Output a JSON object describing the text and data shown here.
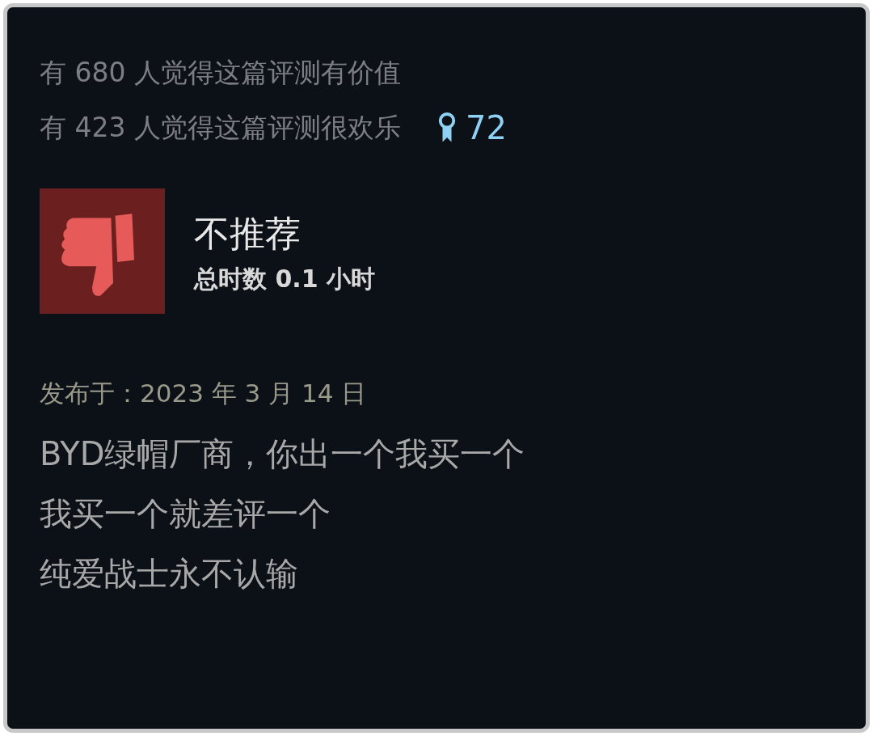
{
  "review": {
    "helpful_text": "有 680 人觉得这篇评测有价值",
    "funny_text": "有 423 人觉得这篇评测很欢乐",
    "award_count": "72",
    "recommended": false,
    "verdict": "不推荐",
    "hours": "总时数 0.1 小时",
    "posted": "发布于：2023 年 3 月 14 日",
    "body_lines": [
      "BYD绿帽厂商，你出一个我买一个",
      "我买一个就差评一个",
      "纯爱战士永不认输"
    ]
  }
}
